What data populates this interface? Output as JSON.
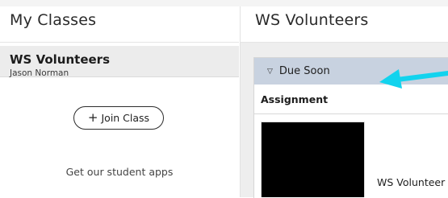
{
  "sidebar": {
    "title": "My Classes",
    "classes": [
      {
        "name": "WS Volunteers",
        "teacher": "Jason Norman"
      }
    ],
    "join_button": {
      "icon": "plus",
      "label": "Join Class"
    },
    "apps_link": "Get our student apps"
  },
  "main": {
    "title": "WS Volunteers",
    "due_section": {
      "caret_icon": "triangle-down-icon",
      "label": "Due Soon"
    },
    "assignment_header": "Assignment",
    "assignments": [
      {
        "title": "WS Volunteer T"
      }
    ]
  },
  "colors": {
    "due_header_bg": "#c8d2e0",
    "annotation_arrow": "#12d3ee",
    "thumbnail": "#000000"
  }
}
